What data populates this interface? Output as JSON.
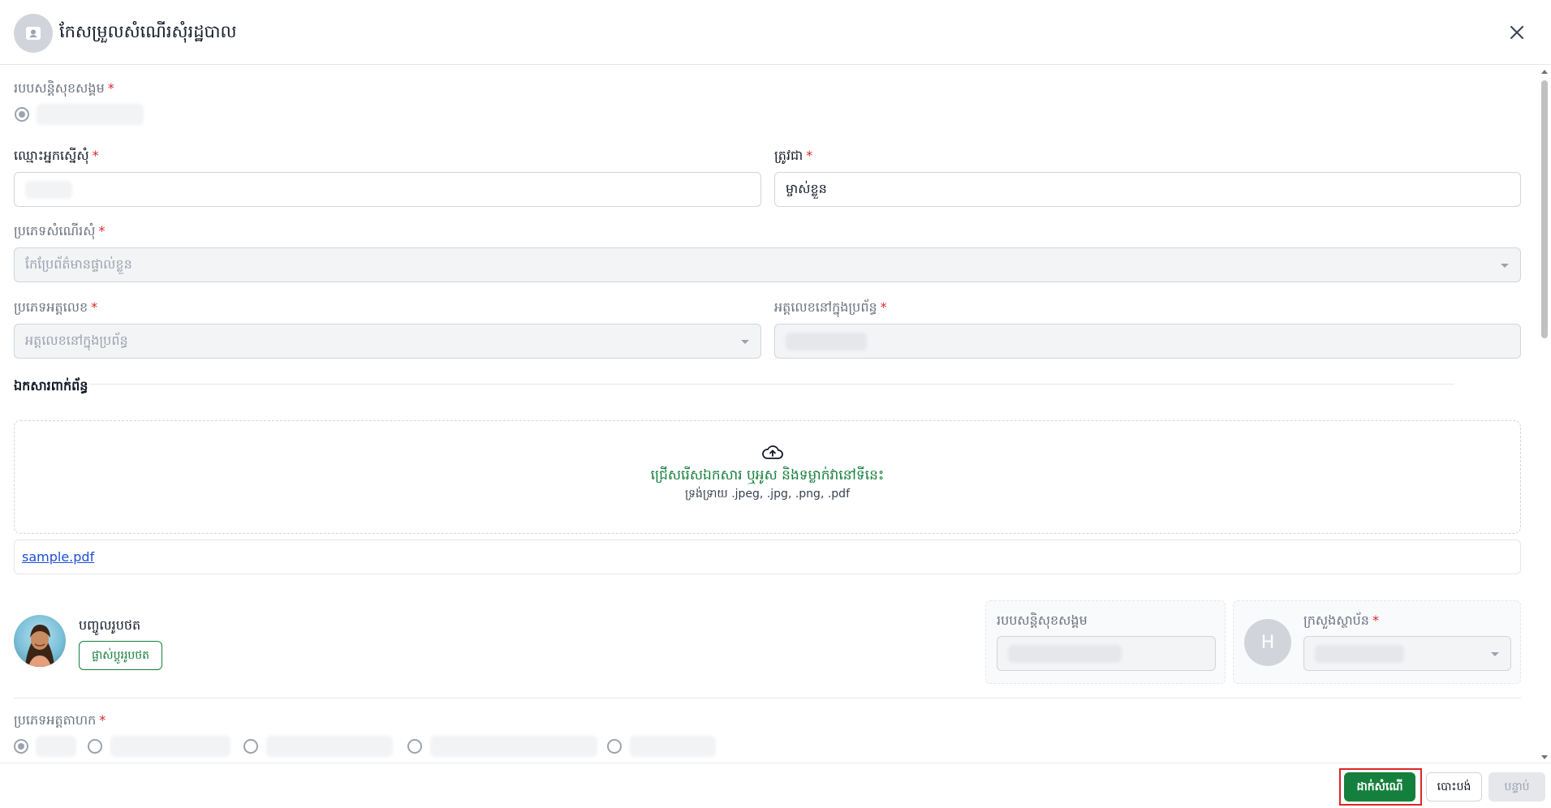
{
  "header": {
    "title": "កែសម្រួលសំណើរសុំរដ្ឋបាល",
    "avatar_icon": "id-card-icon",
    "close_icon": "close-icon"
  },
  "form": {
    "social_security_mode": {
      "label": "របបសន្តិសុខសង្គម",
      "required": "*",
      "selected": true
    },
    "applicant_name": {
      "label": "ឈ្មោះអ្នកស្នើសុំ",
      "required": "*",
      "value": ""
    },
    "role": {
      "label": "ត្រូវជា",
      "required": "*",
      "value": "ម្ចាស់ខ្លួន"
    },
    "request_type": {
      "label": "ប្រភេទសំណើរសុំ",
      "required": "*",
      "value": "កែប្រែព័ត៌មានផ្ទាល់ខ្លួន"
    },
    "id_type": {
      "label": "ប្រភេទអត្តលេខ",
      "required": "*",
      "value": "អត្តលេខនៅក្នុងប្រព័ន្ធ"
    },
    "id_in_system": {
      "label": "អត្តលេខនៅក្នុងប្រព័ន្ធ",
      "required": "*",
      "value": ""
    }
  },
  "attachments": {
    "section_title": "ឯកសារពាក់ព័ន្ធ",
    "dropzone_main": "ជ្រើសរើសឯកសារ ឬអូស និងទម្លាក់វានៅទីនេះ",
    "dropzone_sub": "ទ្រង់ទ្រាយ .jpeg, .jpg, .png, .pdf",
    "files": [
      "sample.pdf"
    ]
  },
  "photo": {
    "label": "បញ្ចូលរូបថត",
    "change_button": "ផ្លាស់ប្តូររូបថត"
  },
  "social_security_panel": {
    "label": "របបសន្តិសុខសង្គម",
    "value": ""
  },
  "ministry_panel": {
    "avatar_letter": "H",
    "label": "ក្រសួងស្ថាប័ន",
    "required": "*",
    "value": ""
  },
  "entity_type": {
    "label": "ប្រភេទអត្តតាហក",
    "required": "*",
    "options_count_visible": 5
  },
  "footer": {
    "submit": "ដាក់សំណើ",
    "cancel": "បោះបង់",
    "next": "បន្ទាប់"
  },
  "colors": {
    "primary": "#15803d",
    "required": "#dc2626",
    "link": "#1d4ed8",
    "highlight": "#dc2626"
  }
}
